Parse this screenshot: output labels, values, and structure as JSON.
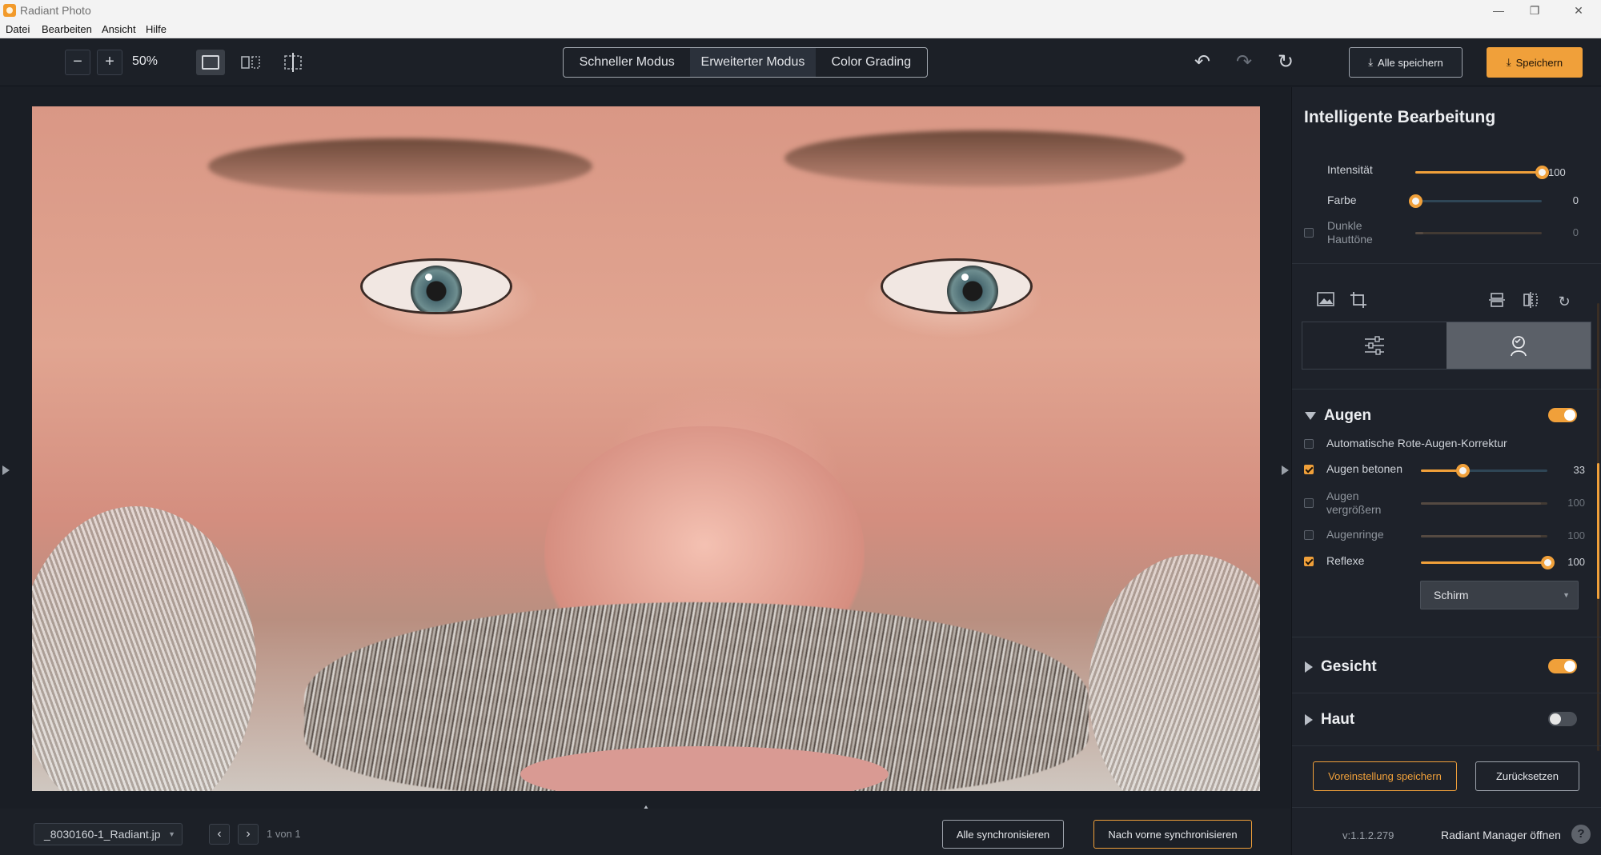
{
  "window": {
    "title": "Radiant Photo",
    "icon": "radiant-logo-icon"
  },
  "menu": {
    "items": [
      "Datei",
      "Bearbeiten",
      "Ansicht",
      "Hilfe"
    ]
  },
  "toolbar": {
    "zoom_value": "50%",
    "modes": [
      "Schneller Modus",
      "Erweiterter Modus",
      "Color Grading"
    ],
    "active_mode": "Erweiterter Modus",
    "save_all_label": "Alle speichern",
    "save_label": "Speichern"
  },
  "bottombar": {
    "filename": "_8030160-1_Radiant.jp",
    "page_count": "1 von 1",
    "sync_all_label": "Alle synchronisieren",
    "sync_forward_label": "Nach vorne synchronisieren"
  },
  "panel": {
    "title": "Intelligente Bearbeitung",
    "smart": {
      "intensity": {
        "label": "Intensität",
        "value": "100",
        "level": 1.0
      },
      "color": {
        "label": "Farbe",
        "value": "0",
        "level": 0.0
      },
      "dark_skin": {
        "label_line1": "Dunkle",
        "label_line2": "Hauttöne",
        "value": "0",
        "checked": false
      }
    },
    "sections": {
      "eyes": {
        "title": "Augen",
        "enabled": true,
        "red_eye": {
          "label": "Automatische Rote-Augen-Korrektur",
          "checked": false
        },
        "enhance": {
          "label": "Augen betonen",
          "value": "33",
          "level": 0.33,
          "checked": true
        },
        "enlarge": {
          "label_line1": "Augen",
          "label_line2": "vergrößern",
          "value": "100",
          "checked": false
        },
        "rings": {
          "label": "Augenringe",
          "value": "100",
          "checked": false
        },
        "reflex": {
          "label": "Reflexe",
          "value": "100",
          "level": 1.0,
          "checked": true
        },
        "blend_mode": "Schirm"
      },
      "face": {
        "title": "Gesicht",
        "enabled": true
      },
      "skin": {
        "title": "Haut",
        "enabled": false
      }
    },
    "save_preset_label": "Voreinstellung speichern",
    "reset_label": "Zurücksetzen",
    "version": "v:1.1.2.279",
    "manager_link": "Radiant Manager öffnen"
  },
  "colors": {
    "accent": "#f0a03a",
    "background": "#1b1f26",
    "panel": "#1e222a"
  }
}
